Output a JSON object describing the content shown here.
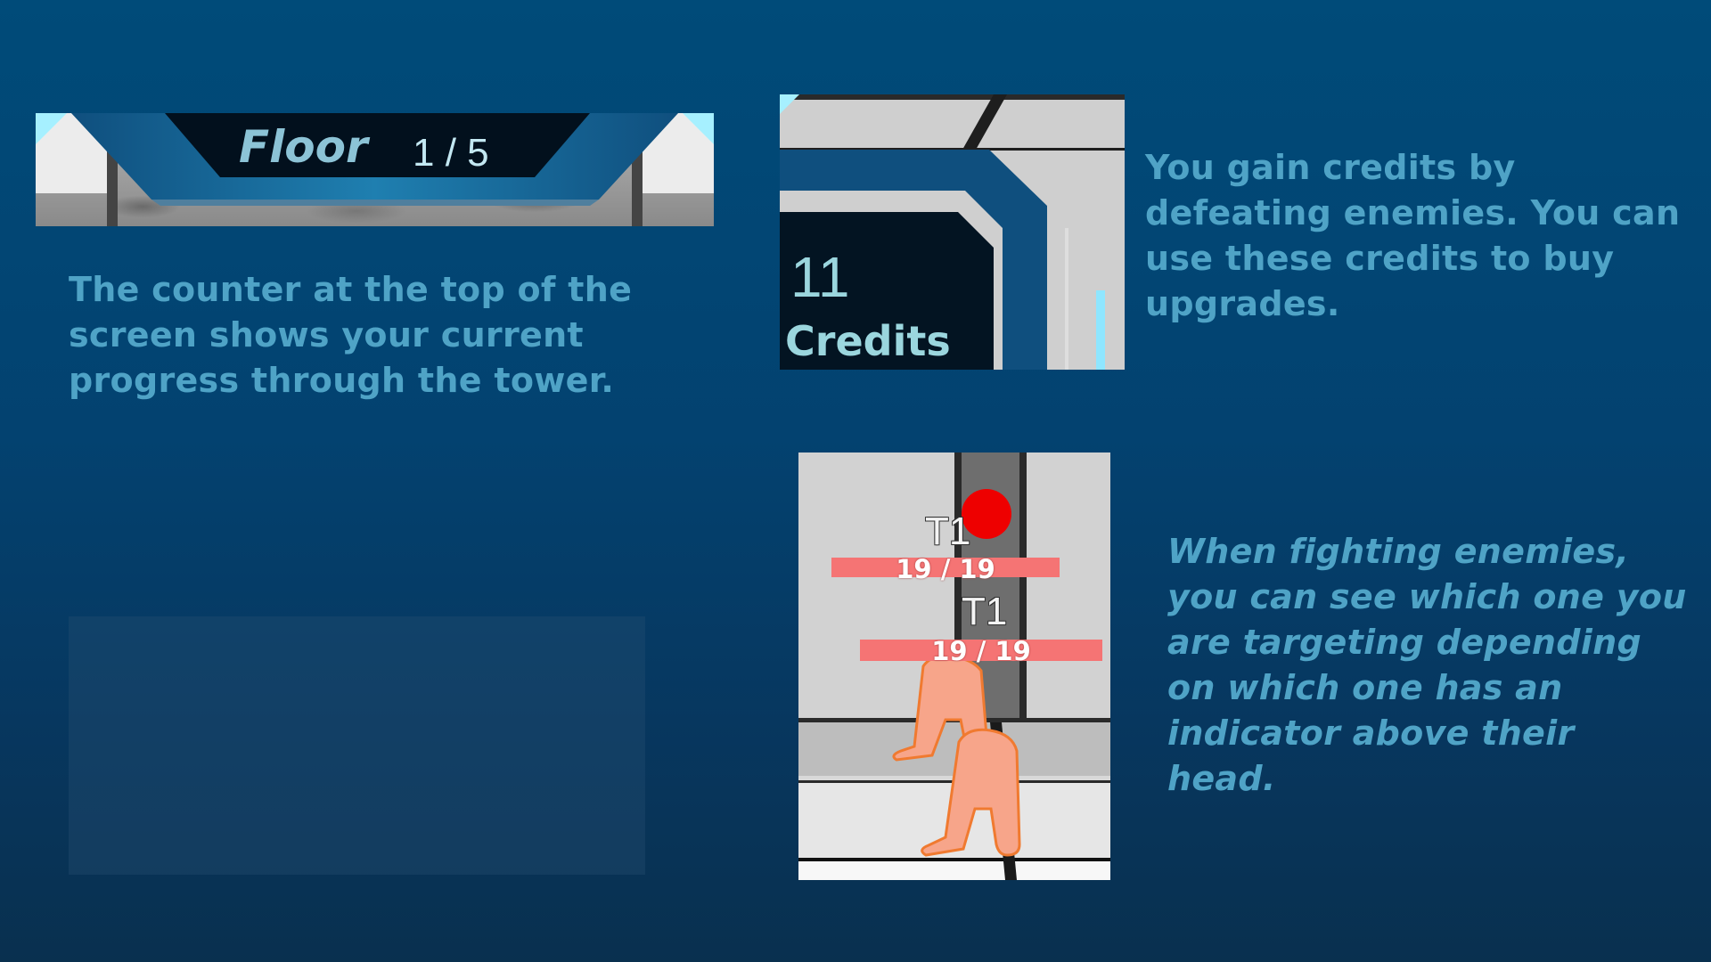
{
  "floor_counter": {
    "label": "Floor",
    "value": "1 / 5",
    "caption": "The counter at the top of the screen shows your current progress through the tower."
  },
  "credits_counter": {
    "value": "11",
    "label": "Credits",
    "caption": "You gain credits by defeating enemies. You can use these credits to buy upgrades."
  },
  "targeting": {
    "enemies": [
      {
        "tag": "T1",
        "health": "19 / 19",
        "targeted": true
      },
      {
        "tag": "T1",
        "health": "19 / 19",
        "targeted": false
      }
    ],
    "caption": "When fighting enemies, you can see which one you are targeting depending on which one has an indicator above their head."
  },
  "colors": {
    "background": "#034270",
    "caption_text": "#4fa3c6",
    "hud_text": "#9bd6de",
    "health_bar": "#f57474",
    "target_indicator": "#ee0000"
  }
}
